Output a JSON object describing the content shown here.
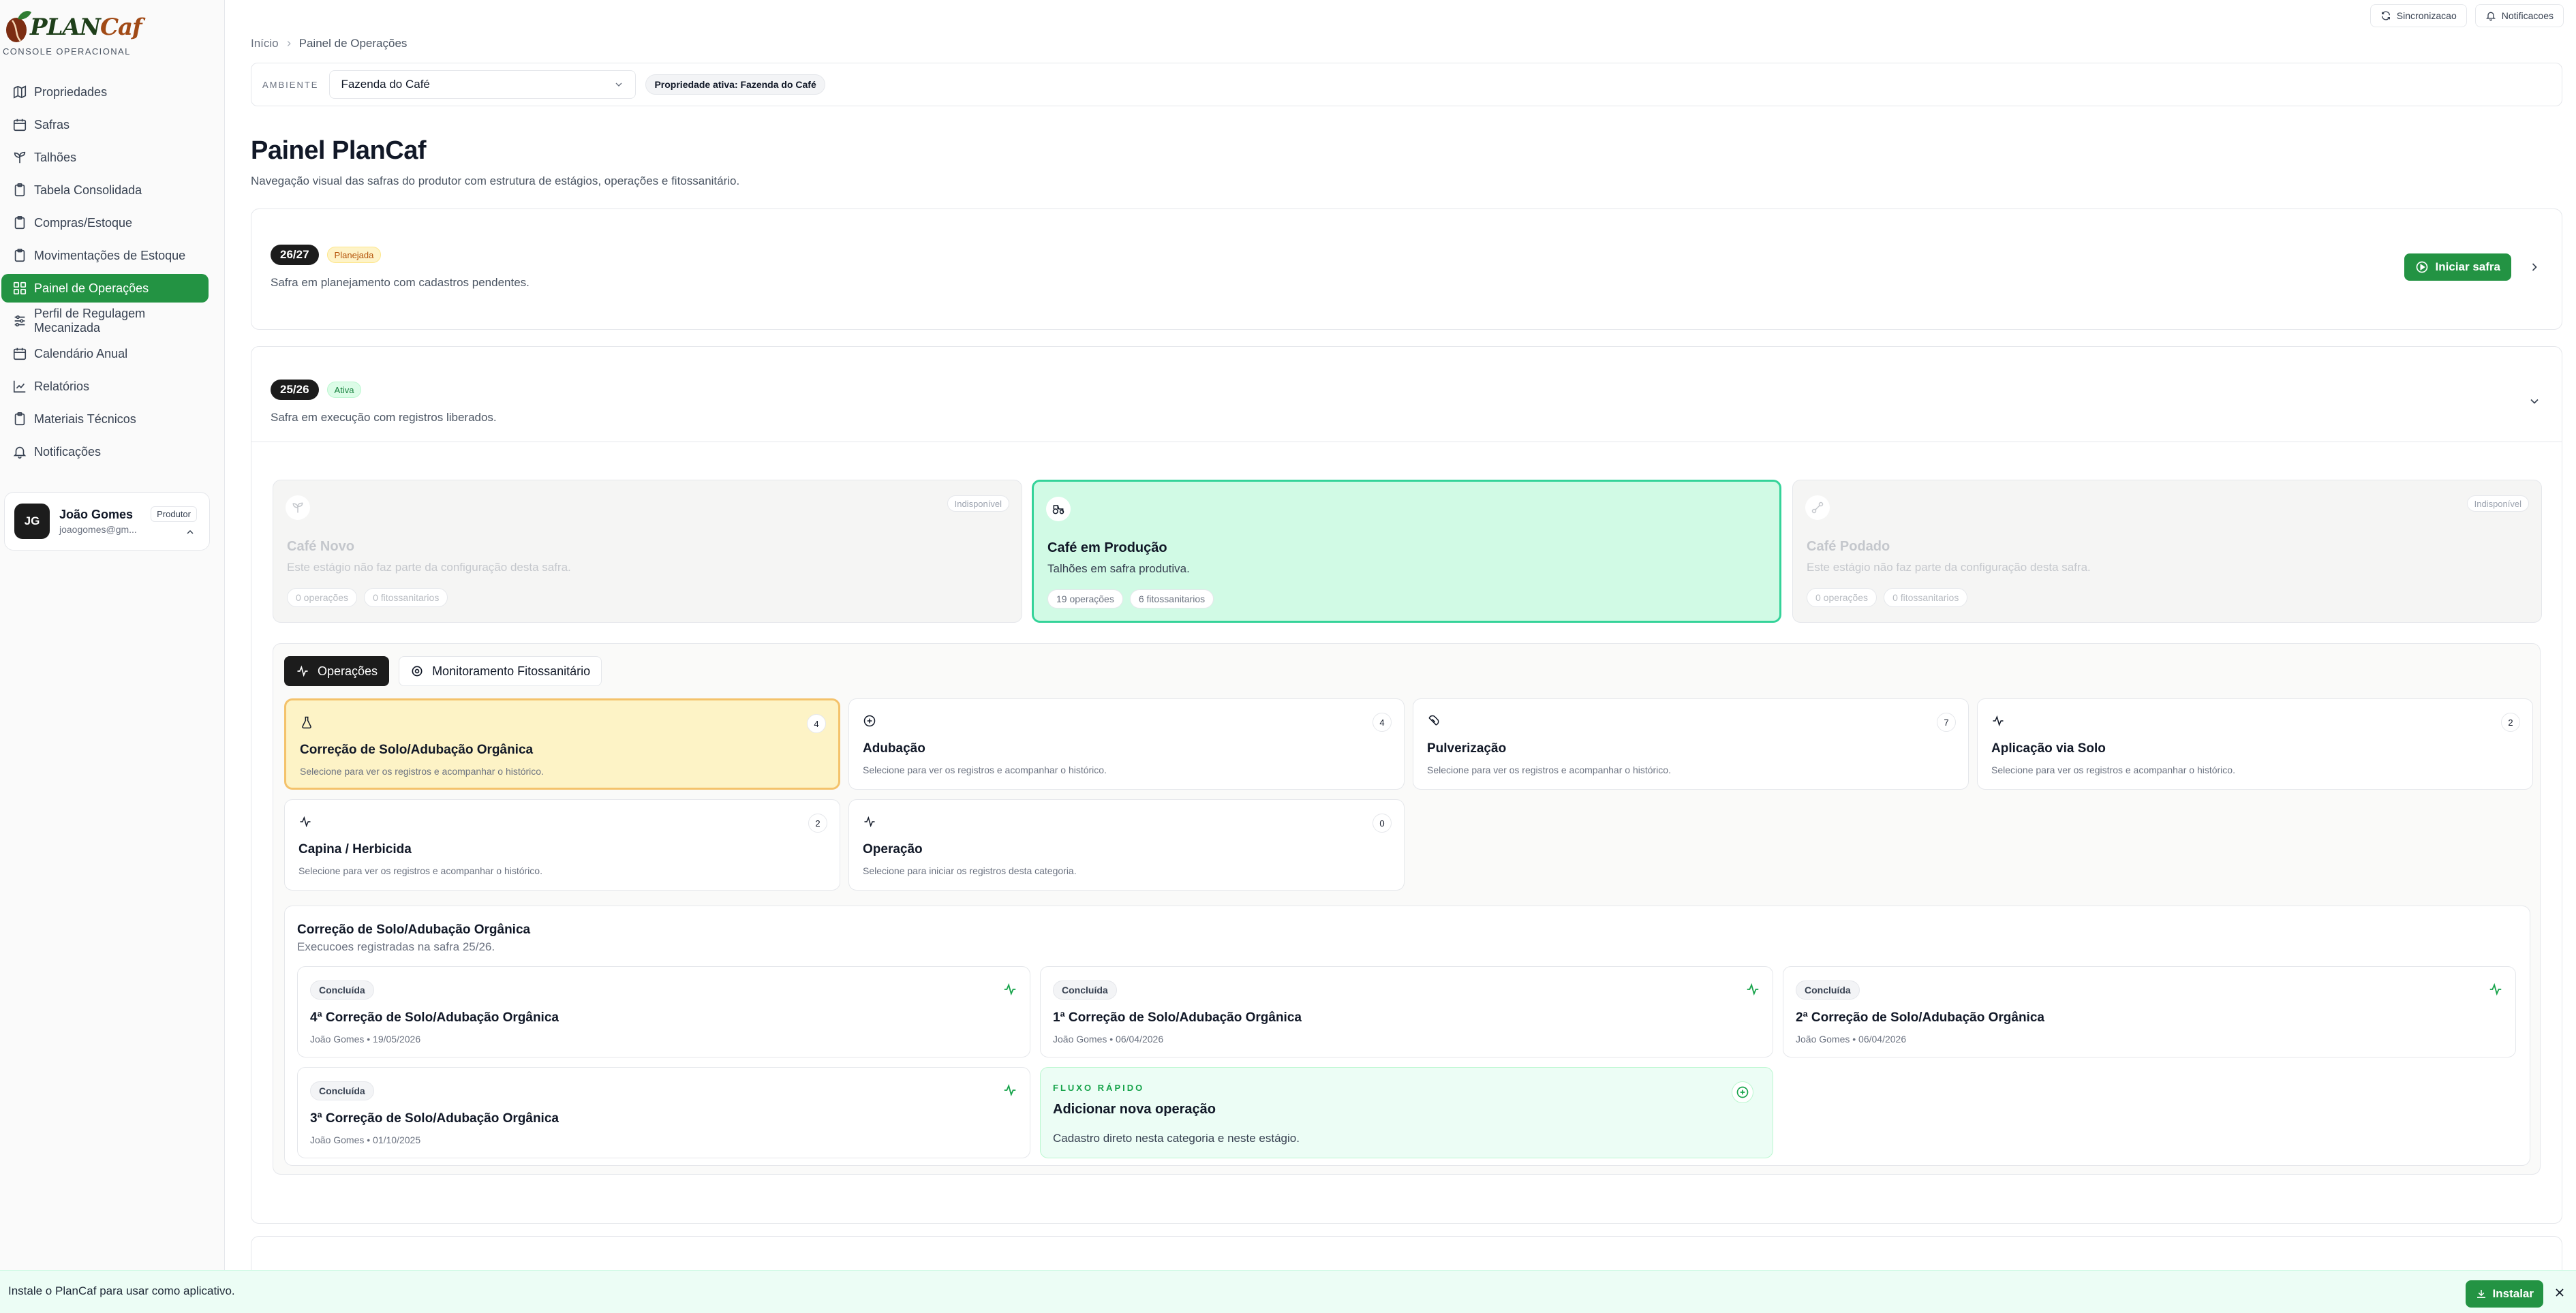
{
  "brand": {
    "word_main": "PLAN",
    "word_accent": "Caf",
    "subtitle": "CONSOLE OPERACIONAL"
  },
  "sidebar": {
    "items": [
      {
        "label": "Propriedades",
        "icon": "map-icon"
      },
      {
        "label": "Safras",
        "icon": "calendar-icon"
      },
      {
        "label": "Talhões",
        "icon": "sprout-icon"
      },
      {
        "label": "Tabela Consolidada",
        "icon": "clipboard-icon"
      },
      {
        "label": "Compras/Estoque",
        "icon": "clipboard-icon"
      },
      {
        "label": "Movimentações de Estoque",
        "icon": "clipboard-icon"
      },
      {
        "label": "Painel de Operações",
        "icon": "grid-icon",
        "active": true
      },
      {
        "label": "Perfil de Regulagem Mecanizada",
        "icon": "sliders-icon"
      },
      {
        "label": "Calendário Anual",
        "icon": "calendar-icon"
      },
      {
        "label": "Relatórios",
        "icon": "chart-icon"
      },
      {
        "label": "Materiais Técnicos",
        "icon": "clipboard-icon"
      },
      {
        "label": "Notificações",
        "icon": "bell-icon"
      }
    ]
  },
  "user": {
    "initials": "JG",
    "name": "João Gomes",
    "email": "joaogomes@gm...",
    "role": "Produtor"
  },
  "topbar": {
    "sync_label": "Sincronizacao",
    "notifications_label": "Notificacoes"
  },
  "breadcrumb": {
    "home": "Início",
    "current": "Painel de Operações"
  },
  "environment": {
    "label": "AMBIENTE",
    "selected": "Fazenda do Café",
    "active_property": "Propriedade ativa: Fazenda do Café"
  },
  "page": {
    "title": "Painel PlanCaf",
    "subtitle": "Navegação visual das safras do produtor com estrutura de estágios, operações e fitossanitário."
  },
  "safras": [
    {
      "year": "26/27",
      "status": "Planejada",
      "description": "Safra em planejamento com cadastros pendentes.",
      "action": "Iniciar safra"
    },
    {
      "year": "25/26",
      "status": "Ativa",
      "description": "Safra em execução com registros liberados."
    }
  ],
  "stages": [
    {
      "title": "Café Novo",
      "description": "Este estágio não faz parte da configuração desta safra.",
      "badge": "Indisponível",
      "ops": "0 operações",
      "phyto": "0 fitossanitarios",
      "icon": "sprout-icon"
    },
    {
      "title": "Café em Produção",
      "description": "Talhões em safra produtiva.",
      "ops": "19 operações",
      "phyto": "6 fitossanitarios",
      "icon": "tractor-icon"
    },
    {
      "title": "Café Podado",
      "description": "Este estágio não faz parte da configuração desta safra.",
      "badge": "Indisponível",
      "ops": "0 operações",
      "phyto": "0 fitossanitarios",
      "icon": "scissors-icon"
    }
  ],
  "tabs": {
    "operations": "Operações",
    "monitoring": "Monitoramento Fitossanitário"
  },
  "categories": [
    {
      "title": "Correção de Solo/Adubação Orgânica",
      "count": "4",
      "description": "Selecione para ver os registros e acompanhar o histórico.",
      "icon": "flask-icon"
    },
    {
      "title": "Adubação",
      "count": "4",
      "description": "Selecione para ver os registros e acompanhar o histórico.",
      "icon": "plus-circle-icon"
    },
    {
      "title": "Pulverização",
      "count": "7",
      "description": "Selecione para ver os registros e acompanhar o histórico.",
      "icon": "spray-icon"
    },
    {
      "title": "Aplicação via Solo",
      "count": "2",
      "description": "Selecione para ver os registros e acompanhar o histórico.",
      "icon": "activity-icon"
    },
    {
      "title": "Capina / Herbicida",
      "count": "2",
      "description": "Selecione para ver os registros e acompanhar o histórico.",
      "icon": "activity-icon"
    },
    {
      "title": "Operação",
      "count": "0",
      "description": "Selecione para iniciar os registros desta categoria.",
      "icon": "activity-icon"
    }
  ],
  "detail": {
    "title": "Correção de Solo/Adubação Orgânica",
    "subtitle": "Execucoes registradas na safra 25/26.",
    "records": [
      {
        "status": "Concluída",
        "title": "4ª Correção de Solo/Adubação Orgânica",
        "meta": "João Gomes • 19/05/2026"
      },
      {
        "status": "Concluída",
        "title": "1ª Correção de Solo/Adubação Orgânica",
        "meta": "João Gomes • 06/04/2026"
      },
      {
        "status": "Concluída",
        "title": "2ª Correção de Solo/Adubação Orgânica",
        "meta": "João Gomes • 06/04/2026"
      },
      {
        "status": "Concluída",
        "title": "3ª Correção de Solo/Adubação Orgânica",
        "meta": "João Gomes • 01/10/2025"
      }
    ],
    "quick_add": {
      "kicker": "FLUXO RÁPIDO",
      "title": "Adicionar nova operação",
      "description": "Cadastro direto nesta categoria e neste estágio."
    }
  },
  "install": {
    "text": "Instale o PlanCaf para usar como aplicativo.",
    "button": "Instalar"
  },
  "colors": {
    "brand_green": "#239343",
    "selected_category": "#fdf3c6",
    "active_stage": "#d1fae5"
  }
}
